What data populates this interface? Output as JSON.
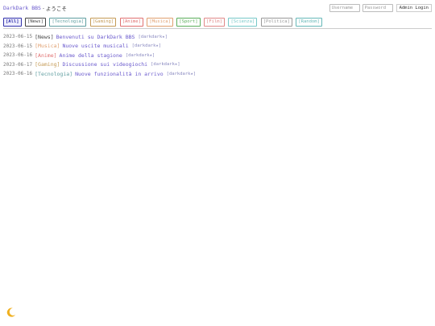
{
  "header": {
    "site_name": "DarkDark BBS",
    "separator": "-",
    "welcome": "ようこそ",
    "username_placeholder": "Username",
    "password_placeholder": "Password",
    "login_button": "Admin Login"
  },
  "tabs": [
    {
      "label": "[All]",
      "color": "#3333aa",
      "active": true
    },
    {
      "label": "[News]",
      "color": "#444444"
    },
    {
      "label": "[Tecnologia]",
      "color": "#5f9ea0"
    },
    {
      "label": "[Gaming]",
      "color": "#c49a55"
    },
    {
      "label": "[Anime]",
      "color": "#e07070"
    },
    {
      "label": "[Musica]",
      "color": "#e0a070"
    },
    {
      "label": "[Sport]",
      "color": "#5aae5a"
    },
    {
      "label": "[Film]",
      "color": "#e08888"
    },
    {
      "label": "[Scienza]",
      "color": "#77c8c8"
    },
    {
      "label": "[Politica]",
      "color": "#999999"
    },
    {
      "label": "[Random]",
      "color": "#66b8b8"
    }
  ],
  "posts": [
    {
      "date": "2023-06-15",
      "category": "[News]",
      "cat_color": "#444444",
      "title": "Benvenuti su DarkDark BBS",
      "author": "[darkdark★]"
    },
    {
      "date": "2023-06-15",
      "category": "[Musica]",
      "cat_color": "#e0a070",
      "title": "Nuove uscite musicali",
      "author": "[darkdark★]"
    },
    {
      "date": "2023-06-16",
      "category": "[Anime]",
      "cat_color": "#e07070",
      "title": "Anime della stagione",
      "author": "[darkdark★]"
    },
    {
      "date": "2023-06-17",
      "category": "[Gaming]",
      "cat_color": "#c49a55",
      "title": "Discussione sui videogiochi",
      "author": "[darkdark★]"
    },
    {
      "date": "2023-06-16",
      "category": "[Tecnologia]",
      "cat_color": "#5f9ea0",
      "title": "Nuove funzionalità in arrivo",
      "author": "[darkdark★]"
    }
  ],
  "theme_toggle": {
    "icon": "crescent-moon-icon"
  },
  "colors": {
    "link": "#6a5acd",
    "moon": "#f0b020"
  }
}
